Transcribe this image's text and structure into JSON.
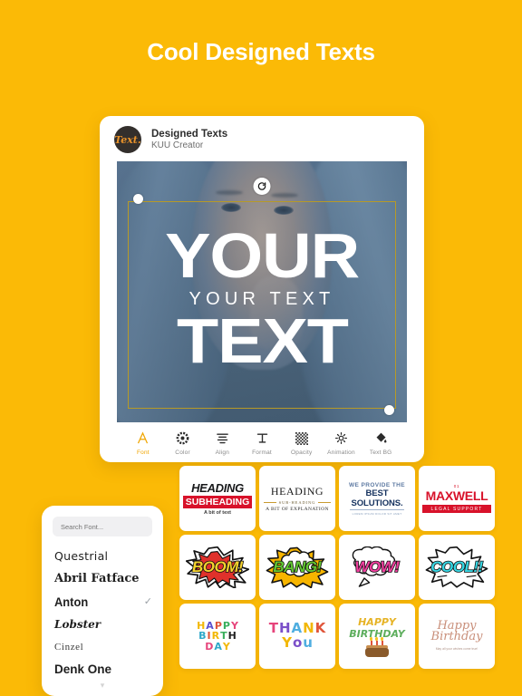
{
  "headline": "Cool Designed Texts",
  "theme": {
    "background": "#FBBA06",
    "accent": "#F0A500",
    "card": "#FFFFFF"
  },
  "app_card": {
    "logo_text": "Text.",
    "title": "Designed Texts",
    "subtitle": "KUU Creator",
    "canvas": {
      "layers": [
        {
          "text": "YOUR",
          "style": "bold-condensed"
        },
        {
          "text": "YOUR TEXT",
          "style": "thin-spaced"
        },
        {
          "text": "TEXT",
          "style": "bold-condensed"
        }
      ],
      "selection_border_color": "#b79a27",
      "rotate_handle_icon": "rotate-icon"
    },
    "toolbar": [
      {
        "label": "Font",
        "icon": "font-a-icon",
        "active": true
      },
      {
        "label": "Color",
        "icon": "color-wheel-icon",
        "active": false
      },
      {
        "label": "Align",
        "icon": "align-center-icon",
        "active": false
      },
      {
        "label": "Format",
        "icon": "text-format-icon",
        "active": false
      },
      {
        "label": "Opacity",
        "icon": "checkerboard-opacity-icon",
        "active": false
      },
      {
        "label": "Animation",
        "icon": "animation-burst-icon",
        "active": false
      },
      {
        "label": "Text BG",
        "icon": "paint-bucket-icon",
        "active": false
      }
    ]
  },
  "font_panel": {
    "search_placeholder": "Search Font...",
    "more_indicator": "▾",
    "fonts": [
      {
        "name": "Questrial",
        "selected": false
      },
      {
        "name": "Abril Fatface",
        "selected": false
      },
      {
        "name": "Anton",
        "selected": true
      },
      {
        "name": "Lobster",
        "selected": false
      },
      {
        "name": "Cinzel",
        "selected": false
      },
      {
        "name": "Denk One",
        "selected": false
      }
    ],
    "check_glyph": "✓"
  },
  "templates": {
    "row1": [
      {
        "heading": "HEADING",
        "subheading": "SUBHEADING",
        "tagline": "A bit of text"
      },
      {
        "heading": "HEADING",
        "subheading": "SUB-HEADING",
        "tagline": "A BIT OF EXPLANATION"
      },
      {
        "line1": "WE PROVIDE THE",
        "line2": "BEST SOLUTIONS.",
        "line3": "LOREM IPSUM DOLOR SIT AMET"
      },
      {
        "number": "01",
        "heading": "MAXWELL",
        "subheading": "LEGAL SUPPORT"
      }
    ],
    "row2": [
      {
        "word": "BOOM!",
        "text_color": "#F6D32D",
        "burst_color": "#E0312B"
      },
      {
        "word": "BANG!",
        "text_color": "#63C832",
        "burst_color": "#F7B500"
      },
      {
        "word": "WOW!",
        "text_color": "#F23FA0",
        "burst_color": "#FFFFFF"
      },
      {
        "word": "COOL!!",
        "text_color": "#36D7E4",
        "burst_color": "#FFFFFF"
      }
    ],
    "row3": [
      {
        "lines": [
          "HAPPY",
          "BIRTH",
          "DAY"
        ],
        "colors": [
          "#F2B705",
          "#5A4FCF",
          "#E0553A",
          "#3AAF5C",
          "#E6447B",
          "#2FA8C9",
          "#E0553A",
          "#F2B705",
          "#3AAF5C",
          "#5A4FCF",
          "#222222",
          "#E6447B",
          "#2FA8C9",
          "#F2B705"
        ]
      },
      {
        "lines": [
          "THANK",
          "YOU"
        ],
        "colors": [
          "#E6447B",
          "#7B4FC9",
          "#4FAEE0",
          "#F2B705",
          "#E0553A",
          "#F2B705",
          "#7B4FC9",
          "#4FAEE0"
        ]
      },
      {
        "line1": "HAPPY",
        "line2": "BIRTHDAY",
        "has_cake": true
      },
      {
        "script": "Happy Birthday",
        "subtitle": "May all your wishes come true!"
      }
    ]
  }
}
